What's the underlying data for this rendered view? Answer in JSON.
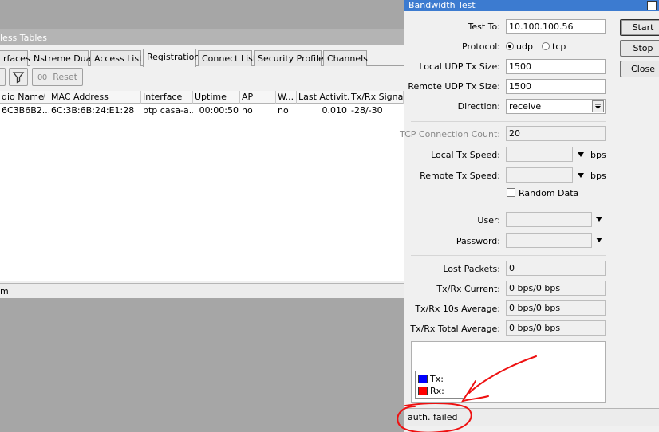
{
  "wireless_tables": {
    "title": "less Tables",
    "tabs": [
      "rfaces",
      "Nstreme Dual",
      "Access List",
      "Registration",
      "Connect List",
      "Security Profiles",
      "Channels"
    ],
    "active_tab": "Registration",
    "toolbar": {
      "reset_label": "Reset",
      "reset_counter": "00"
    },
    "columns": [
      "dio Name",
      "MAC Address",
      "Interface",
      "Uptime",
      "AP",
      "W...",
      "Last Activit...",
      "Tx/Rx Signal"
    ],
    "rows": [
      [
        "6C3B6B2...",
        "6C:3B:6B:24:E1:28",
        "ptp casa-a...",
        "00:00:50",
        "no",
        "no",
        "0.010",
        "-28/-30"
      ]
    ],
    "status_text": "m"
  },
  "bandwidth_test": {
    "title": "Bandwidth Test",
    "buttons": {
      "start": "Start",
      "stop": "Stop",
      "close": "Close"
    },
    "test_to": {
      "label": "Test To:",
      "value": "10.100.100.56"
    },
    "protocol": {
      "label": "Protocol:",
      "options": [
        "udp",
        "tcp"
      ],
      "selected": "udp"
    },
    "local_udp_tx_size": {
      "label": "Local UDP Tx Size:",
      "value": "1500"
    },
    "remote_udp_tx_size": {
      "label": "Remote UDP Tx Size:",
      "value": "1500"
    },
    "direction": {
      "label": "Direction:",
      "value": "receive"
    },
    "tcp_connection_count": {
      "label": "TCP Connection Count:",
      "value": "20"
    },
    "local_tx_speed": {
      "label": "Local Tx Speed:",
      "value": "",
      "unit": "bps"
    },
    "remote_tx_speed": {
      "label": "Remote Tx Speed:",
      "value": "",
      "unit": "bps"
    },
    "random_data": {
      "label": "Random Data",
      "checked": false
    },
    "user": {
      "label": "User:",
      "value": ""
    },
    "password": {
      "label": "Password:",
      "value": ""
    },
    "lost_packets": {
      "label": "Lost Packets:",
      "value": "0"
    },
    "txrx_current": {
      "label": "Tx/Rx Current:",
      "value": "0 bps/0 bps"
    },
    "txrx_10s_avg": {
      "label": "Tx/Rx 10s Average:",
      "value": "0 bps/0 bps"
    },
    "txrx_total_avg": {
      "label": "Tx/Rx Total Average:",
      "value": "0 bps/0 bps"
    },
    "legend": [
      {
        "label": "Tx:",
        "color": "#0000ff"
      },
      {
        "label": "Rx:",
        "color": "#ff0000"
      }
    ],
    "status": "auth. failed"
  },
  "colors": {
    "titlebar_active": "#3c7bd0",
    "titlebar_inactive": "#b4b4b4",
    "annotation": "#ee1111"
  }
}
